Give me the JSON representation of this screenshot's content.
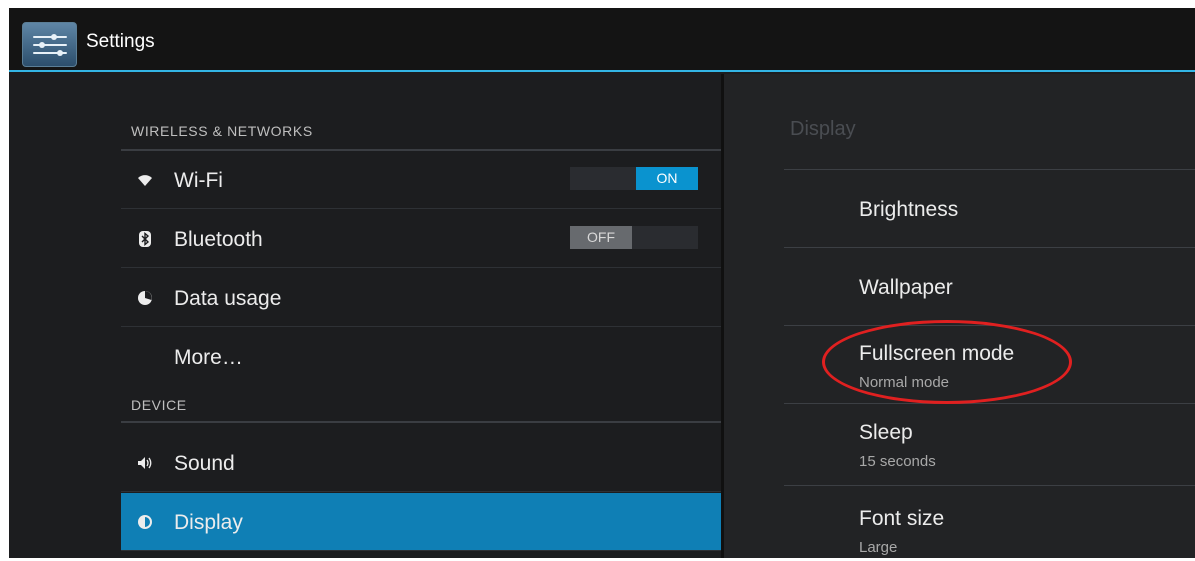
{
  "app": {
    "title": "Settings",
    "icon": "settings-sliders-icon"
  },
  "left": {
    "sections": [
      {
        "header": "WIRELESS & NETWORKS"
      },
      {
        "header": "DEVICE"
      }
    ],
    "items": [
      {
        "label": "Wi-Fi",
        "icon": "wifi-icon",
        "toggle": "ON"
      },
      {
        "label": "Bluetooth",
        "icon": "bluetooth-icon",
        "toggle": "OFF"
      },
      {
        "label": "Data usage",
        "icon": "data-usage-icon"
      },
      {
        "label": "More…"
      },
      {
        "label": "Sound",
        "icon": "sound-icon"
      },
      {
        "label": "Display",
        "icon": "display-icon",
        "selected": true
      }
    ]
  },
  "right": {
    "title": "Display",
    "prefs": [
      {
        "title": "Brightness"
      },
      {
        "title": "Wallpaper"
      },
      {
        "title": "Fullscreen mode",
        "summary": "Normal mode"
      },
      {
        "title": "Sleep",
        "summary": "15 seconds"
      },
      {
        "title": "Font size",
        "summary": "Large"
      }
    ]
  },
  "colors": {
    "accent": "#33b5e5",
    "selected": "#0f7fb5",
    "toggle_on": "#0a93cf",
    "annotation": "#e02020"
  }
}
